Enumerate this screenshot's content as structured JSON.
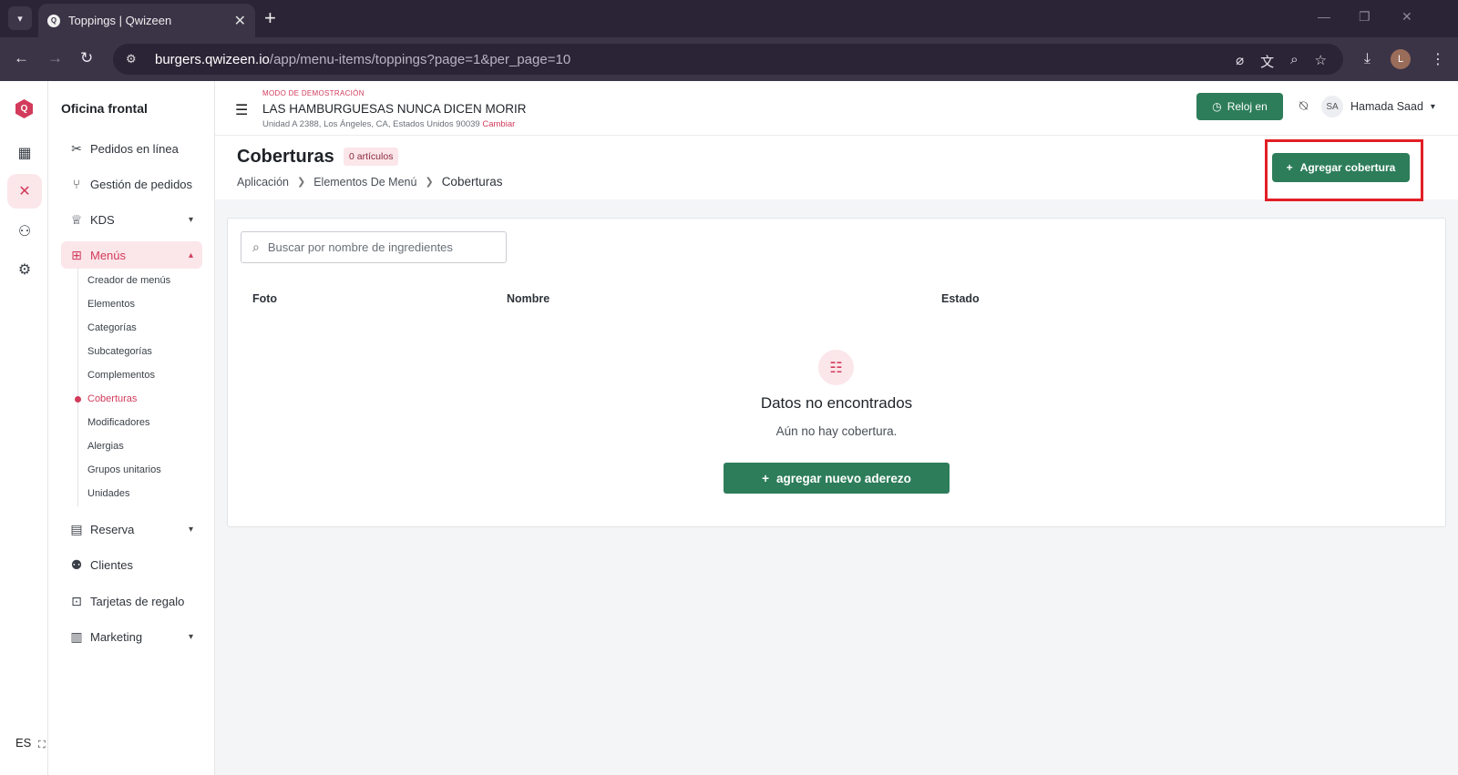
{
  "browser": {
    "tab_title": "Toppings | Qwizeen",
    "tab_favicon": "Q",
    "url_host": "burgers.qwizeen.io",
    "url_path": "/app/menu-items/toppings?page=1&per_page=10",
    "profile_initial": "L"
  },
  "rail": {
    "logo": "Q",
    "language": "ES"
  },
  "sidebar": {
    "brand": "Oficina frontal",
    "items": [
      {
        "label": "Pedidos en línea",
        "icon": "utensils-cross-icon"
      },
      {
        "label": "Gestión de pedidos",
        "icon": "fork-knife-icon"
      },
      {
        "label": "KDS",
        "icon": "chef-hat-icon"
      },
      {
        "label": "Menús",
        "icon": "grid-icon"
      },
      {
        "label": "Reserva",
        "icon": "table-icon"
      },
      {
        "label": "Clientes",
        "icon": "users-icon"
      },
      {
        "label": "Tarjetas de regalo",
        "icon": "gift-icon"
      },
      {
        "label": "Marketing",
        "icon": "bar-chart-icon"
      }
    ],
    "sub_items": [
      {
        "label": "Creador de menús"
      },
      {
        "label": "Elementos"
      },
      {
        "label": "Categorías"
      },
      {
        "label": "Subcategorías"
      },
      {
        "label": "Complementos"
      },
      {
        "label": "Coberturas"
      },
      {
        "label": "Modificadores"
      },
      {
        "label": "Alergias"
      },
      {
        "label": "Grupos unitarios"
      },
      {
        "label": "Unidades"
      }
    ]
  },
  "topbar": {
    "demo_mode": "MODO DE DEMOSTRACIÓN",
    "restaurant_name": "LAS HAMBURGUESAS NUNCA DICEN MORIR",
    "address": "Unidad A 2388, Los Ángeles, CA, Estados Unidos 90039",
    "change_link": "Cambiar",
    "clock_in_label": "Reloj en",
    "user_initials": "SA",
    "user_name": "Hamada Saad"
  },
  "page": {
    "title": "Coberturas",
    "count_badge": "0 artículos",
    "breadcrumb": [
      "Aplicación",
      "Elementos De Menú",
      "Coberturas"
    ],
    "add_button_label": "Agregar cobertura"
  },
  "table": {
    "search_placeholder": "Buscar por nombre de ingredientes",
    "columns": [
      "Foto",
      "Nombre",
      "Estado"
    ],
    "empty_title": "Datos no encontrados",
    "empty_subtitle": "Aún no hay cobertura.",
    "empty_button_label": "agregar nuevo aderezo"
  },
  "colors": {
    "brand_pink": "#d23b5b",
    "primary_green": "#2d7d5a",
    "highlight_red": "#e21f26"
  }
}
